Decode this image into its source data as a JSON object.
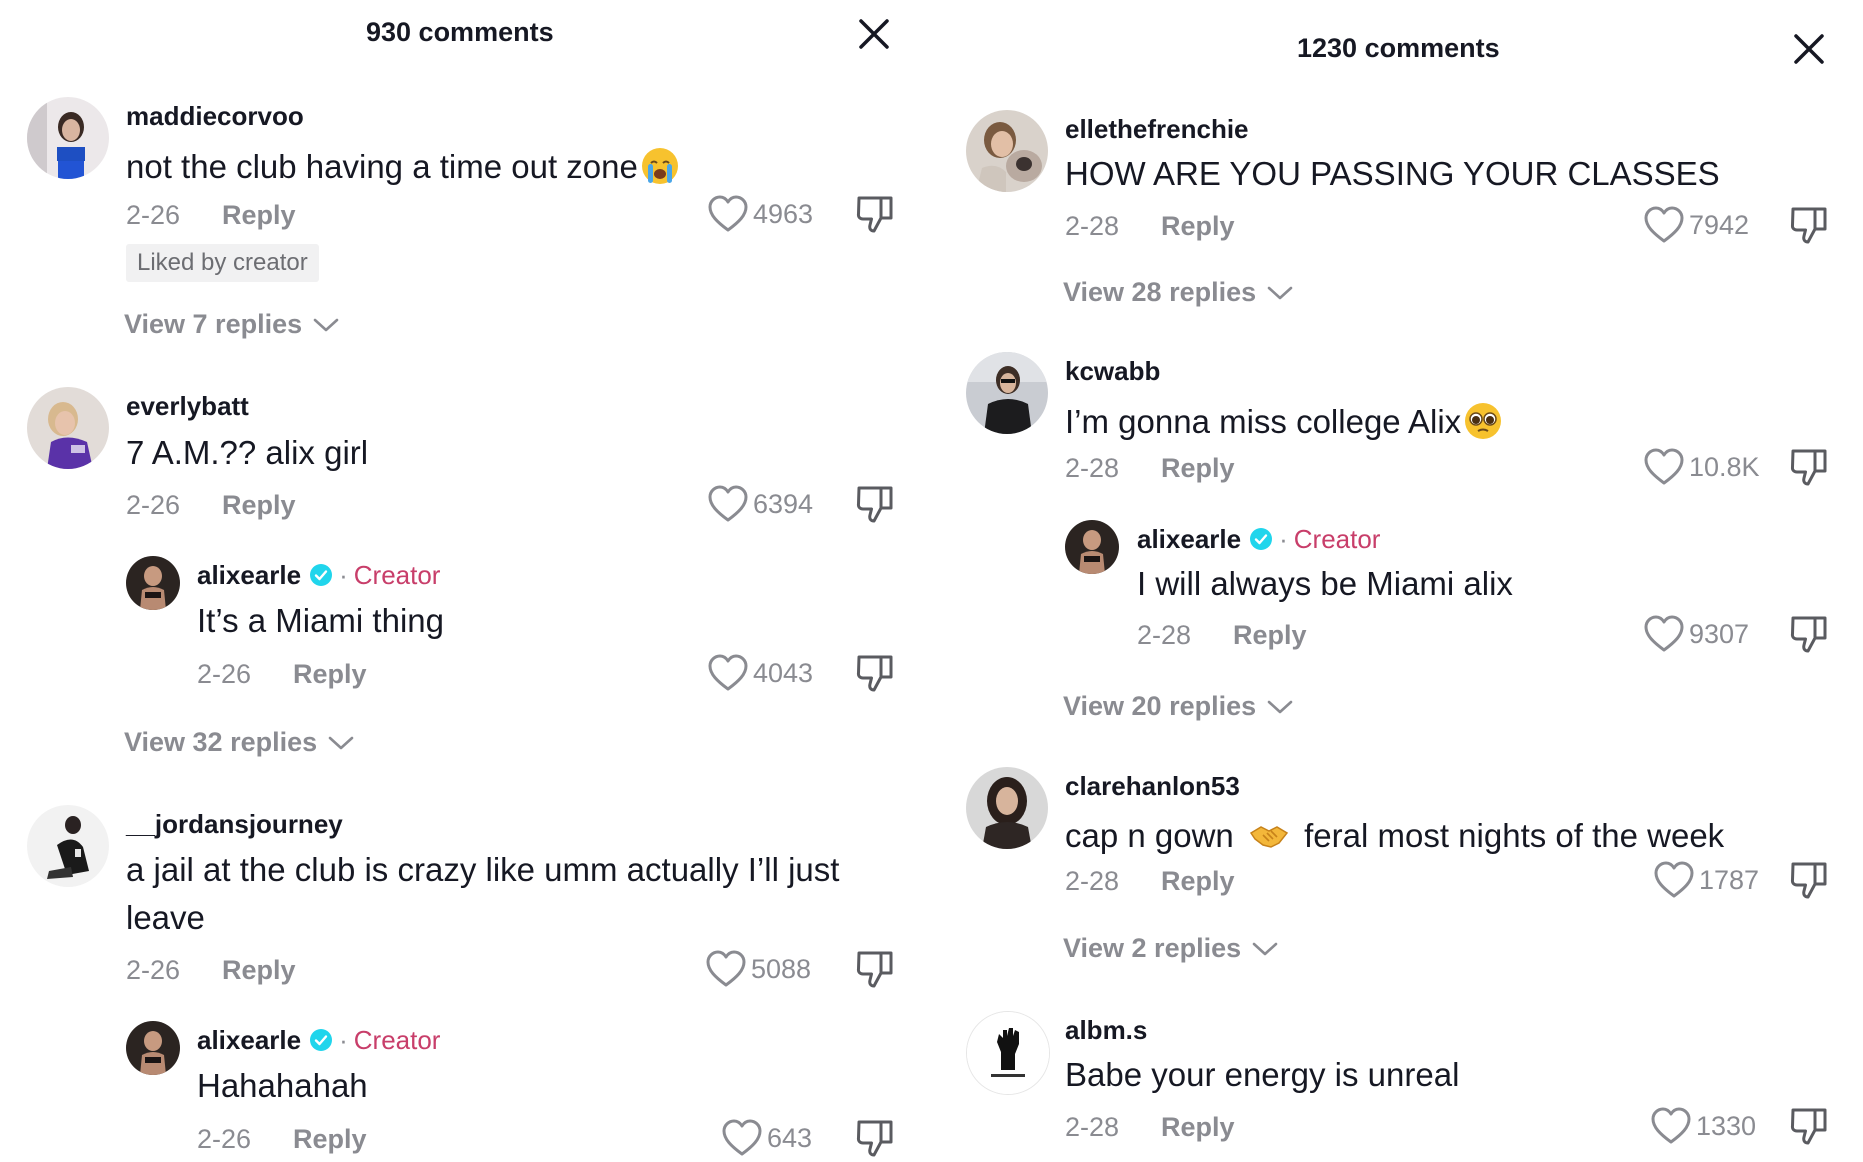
{
  "left_panel": {
    "header_title": "930 comments",
    "comments": [
      {
        "username": "maddiecorvoo",
        "text": "not the club having a time out zone",
        "emoji": "loudly-crying-face",
        "date": "2-26",
        "reply_label": "Reply",
        "likes": "4963",
        "badge": "Liked by creator",
        "view_replies": "View 7 replies"
      },
      {
        "username": "everlybatt",
        "text": "7 A.M.?? alix girl",
        "date": "2-26",
        "reply_label": "Reply",
        "likes": "6394",
        "creator_reply": {
          "username": "alixearle",
          "creator_label": "Creator",
          "text": "It’s a Miami thing",
          "date": "2-26",
          "reply_label": "Reply",
          "likes": "4043"
        },
        "view_replies": "View 32 replies"
      },
      {
        "username": "__jordansjourney",
        "text": "a jail at the club is crazy like umm actually I’ll just leave",
        "date": "2-26",
        "reply_label": "Reply",
        "likes": "5088",
        "creator_reply": {
          "username": "alixearle",
          "creator_label": "Creator",
          "text": "Hahahahah",
          "date": "2-26",
          "reply_label": "Reply",
          "likes": "643"
        }
      }
    ]
  },
  "right_panel": {
    "header_title": "1230 comments",
    "comments": [
      {
        "username": "ellethefrenchie",
        "text": "HOW ARE YOU PASSING YOUR CLASSES",
        "date": "2-28",
        "reply_label": "Reply",
        "likes": "7942",
        "view_replies": "View 28 replies"
      },
      {
        "username": "kcwabb",
        "text": "I’m gonna miss college Alix",
        "emoji": "pleading-face",
        "date": "2-28",
        "reply_label": "Reply",
        "likes": "10.8K",
        "creator_reply": {
          "username": "alixearle",
          "creator_label": "Creator",
          "text": "I will always be Miami alix",
          "date": "2-28",
          "reply_label": "Reply",
          "likes": "9307"
        },
        "view_replies": "View 20 replies"
      },
      {
        "username": "clarehanlon53",
        "text_before": "cap n gown",
        "emoji": "handshake",
        "text_after": "feral most nights of the week",
        "date": "2-28",
        "reply_label": "Reply",
        "likes": "1787",
        "view_replies": "View 2 replies"
      },
      {
        "username": "albm.s",
        "text": "Babe your energy is unreal",
        "date": "2-28",
        "reply_label": "Reply",
        "likes": "1330"
      }
    ]
  },
  "colors": {
    "text": "#161823",
    "secondary": "#8a8b91",
    "creator": "#c83e6a",
    "verified": "#20d5ec",
    "badge_bg": "#f1f1f2"
  },
  "icons": [
    "close-icon",
    "heart-icon",
    "dislike-icon",
    "verified-icon",
    "chevron-down-icon"
  ]
}
